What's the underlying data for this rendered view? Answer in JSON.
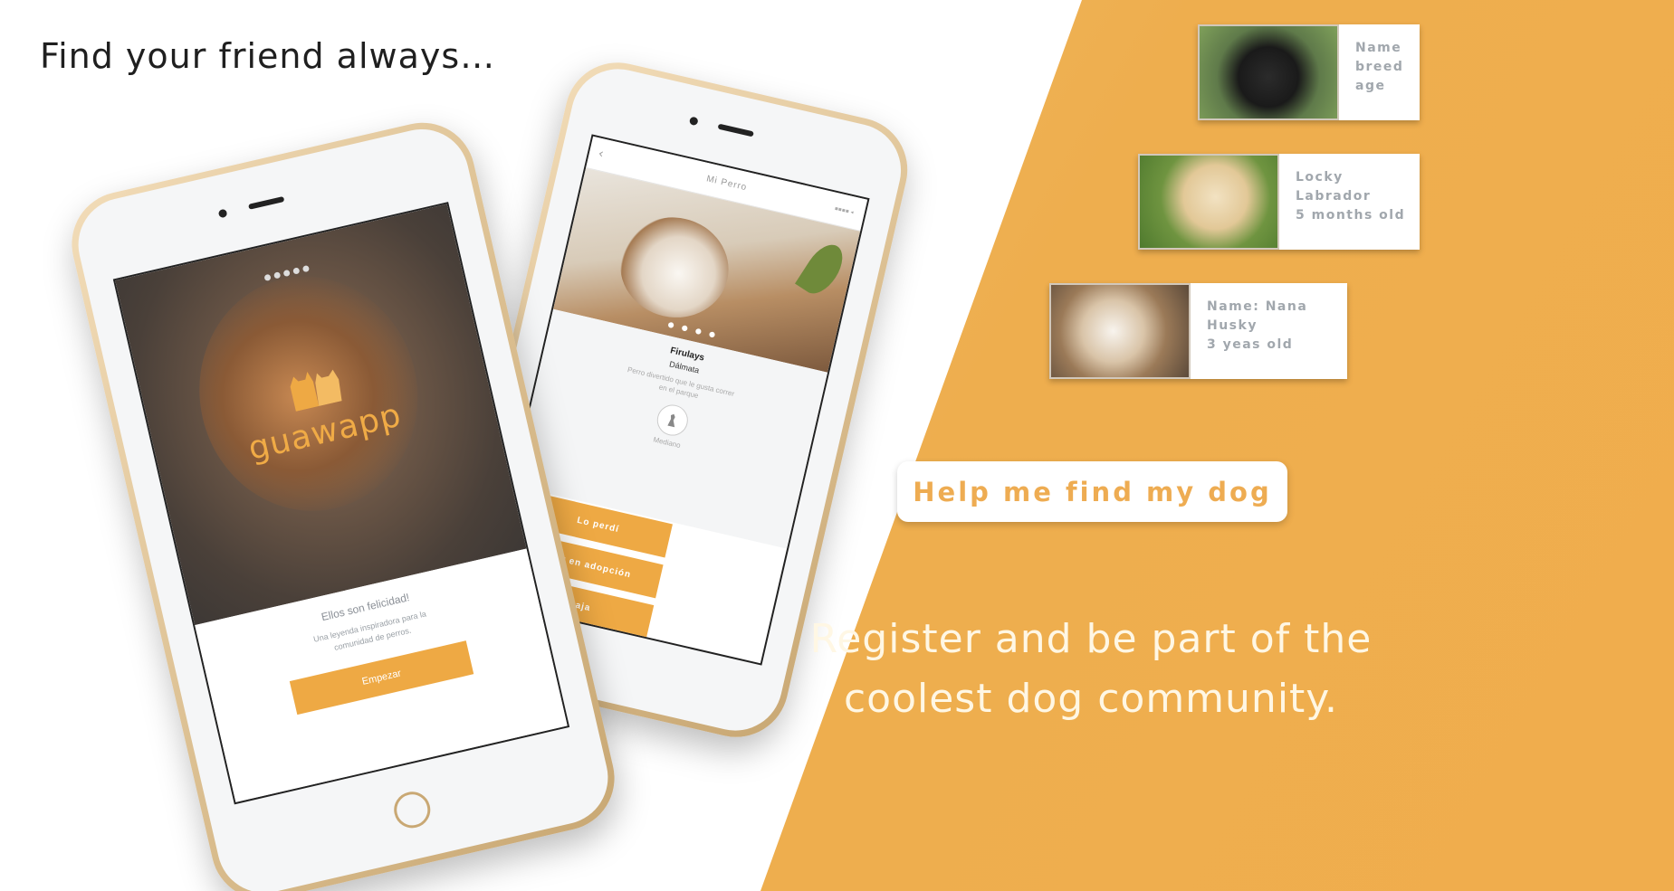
{
  "headline": "Find your friend always…",
  "colors": {
    "accent": "#eea944",
    "panel_orange": "#efb059",
    "card_text": "#a1a7ad"
  },
  "phone_front": {
    "logo_text": "guawapp",
    "logo_icon": "dog-and-cat-logo-icon",
    "pager": "●●●●●",
    "title": "Ellos son felicidad!",
    "subtitle": "Una leyenda inspiradora para la comunidad de perros.",
    "button": "Empezar"
  },
  "phone_back": {
    "back_icon": "chevron-left-icon",
    "title": "Mi Perro",
    "badge": "▪▪▪▪ ◂",
    "pager": "● ● ● ●",
    "pet_name": "Firulays",
    "pet_breed": "Dálmata",
    "pet_description": "Perro divertido que le gusta correr en el parque",
    "size_icon": "dog-sitting-icon",
    "size_label": "Mediano",
    "buttons": [
      "Lo perdí",
      "Doy en adopción",
      "Baja"
    ]
  },
  "dog_cards": [
    {
      "photo_icon": "black-puppy-photo",
      "lines": [
        "Name",
        "breed",
        "age"
      ]
    },
    {
      "photo_icon": "golden-puppy-photo",
      "lines": [
        "Locky",
        "Labrador",
        "5 months old"
      ]
    },
    {
      "photo_icon": "husky-photo",
      "lines": [
        "Name: Nana",
        "Husky",
        "3 yeas old"
      ]
    }
  ],
  "cta_button": "Help me find my dog",
  "tagline": [
    "Register and be part of the",
    "coolest dog community."
  ]
}
